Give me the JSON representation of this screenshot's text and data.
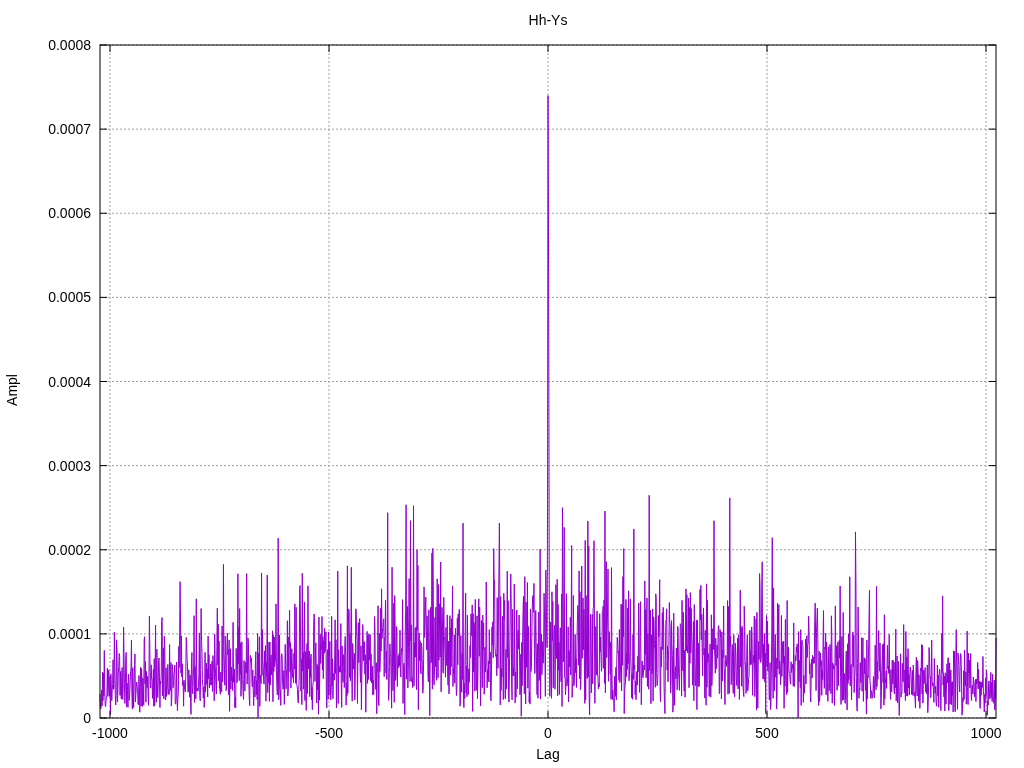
{
  "chart": {
    "title": "Hh-Ys",
    "xlabel": "Lag",
    "ylabel": "Ampl",
    "xticks": [
      "-1000",
      "-500",
      "0",
      "500",
      "1000"
    ],
    "yticks": [
      "0.0008",
      "0.0007",
      "0.0006",
      "0.0005",
      "0.0004",
      "0.0003",
      "0.0002",
      "0.0001",
      "0"
    ]
  }
}
